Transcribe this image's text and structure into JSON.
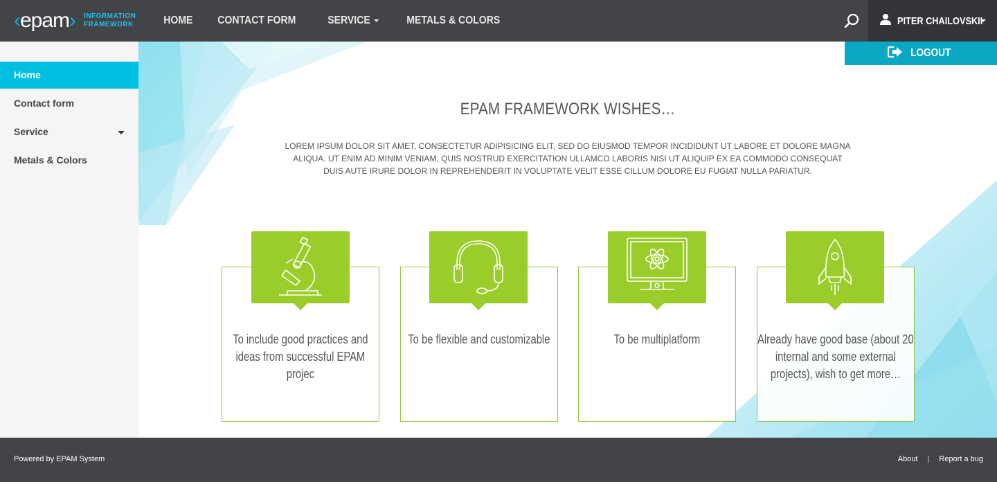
{
  "brand": {
    "logo_text": "epam",
    "subtitle_line1": "INFORMATION",
    "subtitle_line2": "FRAMEWORK",
    "accent": "#00b2d6"
  },
  "header": {
    "nav": [
      {
        "label": "HOME"
      },
      {
        "label": "CONTACT FORM"
      },
      {
        "label": "SERVICE",
        "has_dropdown": true
      },
      {
        "label": "METALS & COLORS"
      }
    ],
    "search_icon": "search-icon",
    "user_name": "PITER CHAILOVSKII",
    "logout_label": "LOGOUT"
  },
  "sidebar": {
    "items": [
      {
        "label": "Home",
        "active": true
      },
      {
        "label": "Contact form"
      },
      {
        "label": "Service",
        "has_dropdown": true
      },
      {
        "label": "Metals & Colors"
      }
    ]
  },
  "main": {
    "title": "EPAM FRAMEWORK WISHES…",
    "text": "LOREM IPSUM DOLOR SIT AMET, CONSECTETUR ADIPISICING ELIT, SED DO EIUSMOD TEMPOR INCIDIDUNT UT LABORE ET DOLORE MAGNA ALIQUA. UT ENIM AD MINIM VENIAM, QUIS NOSTRUD EXERCITATION ULLAMCO LABORIS NISI UT ALIQUIP EX EA COMMODO CONSEQUAT DUIS AUTE IRURE DOLOR IN REPREHENDERIT IN VOLUPTATE VELIT ESSE CILLUM DOLORE EU FUGIAT NULLA PARIATUR.",
    "benefits": [
      {
        "icon": "microscope-icon",
        "text": "To include good practices and ideas from successful EPAM projec"
      },
      {
        "icon": "headset-icon",
        "text": "To be flexible and customizable"
      },
      {
        "icon": "monitor-icon",
        "text": "To be multiplatform"
      },
      {
        "icon": "rocket-icon",
        "text": "Already have good base (about 20 internal and some external projects), wish to get more…"
      }
    ],
    "badge_color": "#9acd2a",
    "border_color": "#8ec63f"
  },
  "footer": {
    "powered_by": "Powered by EPAM System",
    "about": "About",
    "separator": "|",
    "report_bug": "Report a bug"
  }
}
